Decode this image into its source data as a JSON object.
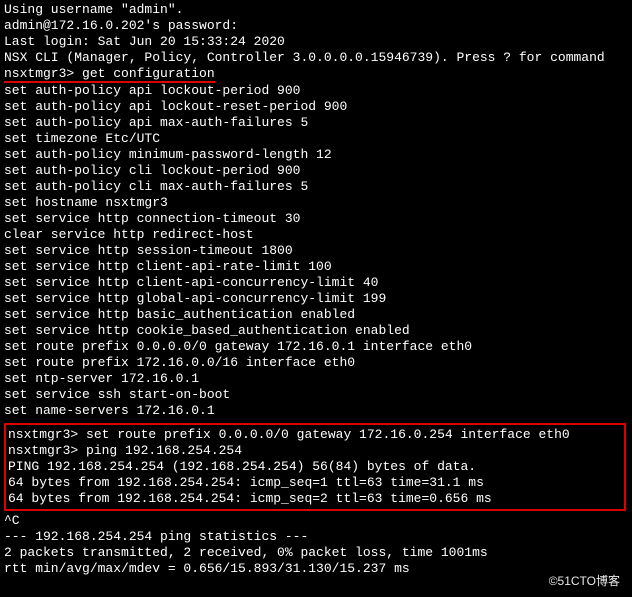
{
  "header": {
    "line1": "Using username \"admin\".",
    "line2": "admin@172.16.0.202's password:",
    "line3": "Last login: Sat Jun 20 15:33:24 2020",
    "line4": "NSX CLI (Manager, Policy, Controller 3.0.0.0.0.15946739). Press ? for command"
  },
  "prompt1": {
    "prompt": "nsxtmgr3>",
    "command": "get configuration"
  },
  "blank": "",
  "config_lines": [
    "set auth-policy api lockout-period 900",
    "set auth-policy api lockout-reset-period 900",
    "set auth-policy api max-auth-failures 5",
    "set timezone Etc/UTC",
    "set auth-policy minimum-password-length 12",
    "set auth-policy cli lockout-period 900",
    "set auth-policy cli max-auth-failures 5",
    "set hostname nsxtmgr3",
    "set service http connection-timeout 30",
    "clear service http redirect-host",
    "set service http session-timeout 1800",
    "set service http client-api-rate-limit 100",
    "set service http client-api-concurrency-limit 40",
    "set service http global-api-concurrency-limit 199",
    "set service http basic_authentication enabled",
    "set service http cookie_based_authentication enabled",
    "set route prefix 0.0.0.0/0 gateway 172.16.0.1 interface eth0",
    "set route prefix 172.16.0.0/16 interface eth0",
    "set ntp-server 172.16.0.1",
    "set service ssh start-on-boot",
    "set name-servers 172.16.0.1"
  ],
  "box": {
    "line1": "nsxtmgr3> set route prefix 0.0.0.0/0 gateway 172.16.0.254 interface eth0",
    "line2": "nsxtmgr3> ping 192.168.254.254",
    "line3": "PING 192.168.254.254 (192.168.254.254) 56(84) bytes of data.",
    "line4": "64 bytes from 192.168.254.254: icmp_seq=1 ttl=63 time=31.1 ms",
    "line5": "64 bytes from 192.168.254.254: icmp_seq=2 ttl=63 time=0.656 ms"
  },
  "footer": {
    "ctrlc": "^C",
    "stats1": "--- 192.168.254.254 ping statistics ---",
    "stats2": "2 packets transmitted, 2 received, 0% packet loss, time 1001ms",
    "stats3": "rtt min/avg/max/mdev = 0.656/15.893/31.130/15.237 ms"
  },
  "watermark": "©51CTO博客"
}
